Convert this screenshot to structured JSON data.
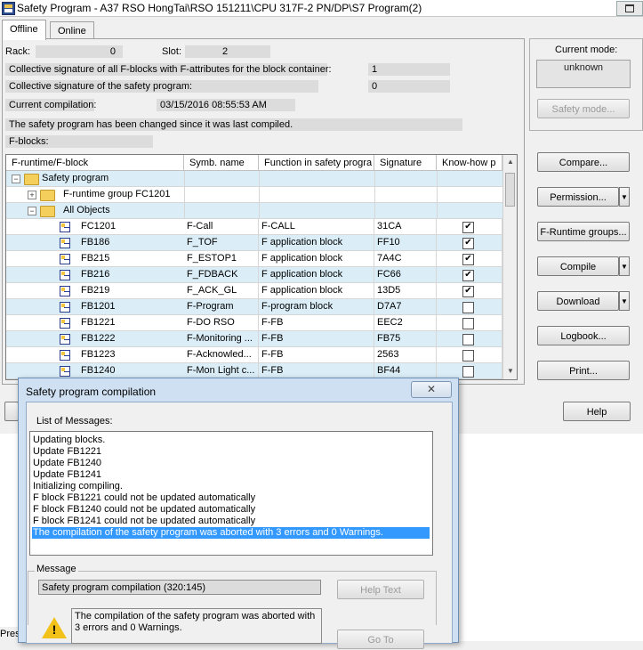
{
  "window": {
    "title": "Safety Program - A37 RSO HongTai\\RSO 151211\\CPU 317F-2 PN/DP\\S7 Program(2)"
  },
  "tabs": [
    {
      "label": "Offline",
      "active": true
    },
    {
      "label": "Online",
      "active": false
    }
  ],
  "info": {
    "rack_label": "Rack:",
    "rack_value": "0",
    "slot_label": "Slot:",
    "slot_value": "2",
    "collective_fblocks_label": "Collective signature of all F-blocks with F-attributes for the block container:",
    "collective_fblocks_value": "1",
    "collective_program_label": "Collective signature of the safety program:",
    "collective_program_value": "0",
    "compilation_label": "Current compilation:",
    "compilation_value": "03/15/2016 08:55:53 AM",
    "changed_notice": "The safety program has been changed since it was last compiled.",
    "fblocks_label": "F-blocks:"
  },
  "grid": {
    "columns": [
      "F-runtime/F-block",
      "Symb. name",
      "Function in safety progra",
      "Signature",
      "Know-how p"
    ],
    "tree": [
      {
        "label": "Safety program",
        "level": 0,
        "expander": "−"
      },
      {
        "label": "F-runtime group FC1201",
        "level": 1,
        "expander": "+"
      },
      {
        "label": "All Objects",
        "level": 1,
        "expander": "−"
      }
    ],
    "rows": [
      {
        "block": "FC1201",
        "symbol": "F-Call",
        "function": "F-CALL",
        "signature": "31CA",
        "knowhow": true,
        "yellow_icon": true
      },
      {
        "block": "FB186",
        "symbol": "F_TOF",
        "function": "F application block",
        "signature": "FF10",
        "knowhow": true,
        "yellow_icon": true
      },
      {
        "block": "FB215",
        "symbol": "F_ESTOP1",
        "function": "F application block",
        "signature": "7A4C",
        "knowhow": true,
        "yellow_icon": true
      },
      {
        "block": "FB216",
        "symbol": "F_FDBACK",
        "function": "F application block",
        "signature": "FC66",
        "knowhow": true,
        "yellow_icon": true
      },
      {
        "block": "FB219",
        "symbol": "F_ACK_GL",
        "function": "F application block",
        "signature": "13D5",
        "knowhow": true,
        "yellow_icon": true
      },
      {
        "block": "FB1201",
        "symbol": "F-Program",
        "function": "F-program block",
        "signature": "D7A7",
        "knowhow": false,
        "yellow_icon": false
      },
      {
        "block": "FB1221",
        "symbol": "F-DO RSO",
        "function": "F-FB",
        "signature": "EEC2",
        "knowhow": false,
        "yellow_icon": false
      },
      {
        "block": "FB1222",
        "symbol": "F-Monitoring ...",
        "function": "F-FB",
        "signature": "FB75",
        "knowhow": false,
        "yellow_icon": false
      },
      {
        "block": "FB1223",
        "symbol": "F-Acknowled...",
        "function": "F-FB",
        "signature": "2563",
        "knowhow": false,
        "yellow_icon": false
      },
      {
        "block": "FB1240",
        "symbol": "F-Mon Light c...",
        "function": "F-FB",
        "signature": "BF44",
        "knowhow": false,
        "yellow_icon": false
      }
    ]
  },
  "right_panel": {
    "mode_label": "Current mode:",
    "mode_value": "unknown",
    "safety_mode_button": "Safety mode...",
    "compare_button": "Compare...",
    "permission_button": "Permission...",
    "fruntime_button": "F-Runtime groups...",
    "compile_button": "Compile",
    "download_button": "Download",
    "logbook_button": "Logbook...",
    "print_button": "Print...",
    "help_button": "Help"
  },
  "dialog": {
    "title": "Safety program compilation",
    "close_glyph": "✕",
    "list_label": "List of Messages:",
    "messages": [
      "Updating blocks.",
      "Update FB1221",
      "Update FB1240",
      "Update FB1241",
      "Initializing compiling.",
      "F block FB1221 could not be updated automatically",
      "F block FB1240 could not be updated automatically",
      "F block FB1241 could not be updated automatically",
      "The compilation of the safety program was aborted with 3 errors and 0 Warnings."
    ],
    "selected_index": 8,
    "message_group_label": "Message",
    "message_field": "Safety program compilation (320:145)",
    "help_text_button": "Help Text",
    "message_text": "The compilation of the safety program was aborted with 3 errors and 0 Warnings.",
    "goto_button": "Go To",
    "warning_glyph": "!"
  },
  "statusbar": {
    "text": "Pres"
  }
}
